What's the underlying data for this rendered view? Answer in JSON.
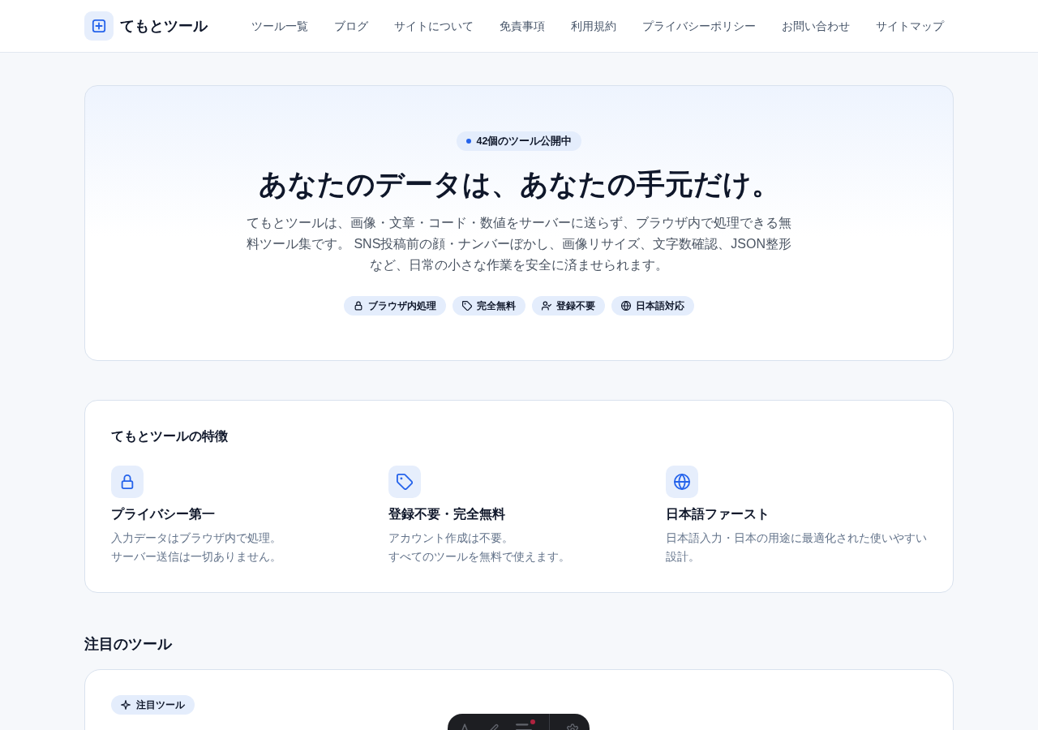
{
  "header": {
    "logo_text": "てもとツール",
    "nav": [
      "ツール一覧",
      "ブログ",
      "サイトについて",
      "免責事項",
      "利用規約",
      "プライバシーポリシー",
      "お問い合わせ",
      "サイトマップ"
    ]
  },
  "hero": {
    "badge": "42個のツール公開中",
    "title": "あなたのデータは、あなたの手元だけ。",
    "description": "てもとツールは、画像・文章・コード・数値をサーバーに送らず、ブラウザ内で処理できる無料ツール集です。 SNS投稿前の顔・ナンバーぼかし、画像リサイズ、文字数確認、JSON整形など、日常の小さな作業を安全に済ませられます。",
    "tags": [
      {
        "kind": "lock",
        "label": "ブラウザ内処理"
      },
      {
        "kind": "tag",
        "label": "完全無料"
      },
      {
        "kind": "user-check",
        "label": "登録不要"
      },
      {
        "kind": "globe",
        "label": "日本語対応"
      }
    ]
  },
  "features": {
    "title": "てもとツールの特徴",
    "items": [
      {
        "kind": "lock",
        "title": "プライバシー第一",
        "lines": [
          "入力データはブラウザ内で処理。",
          "サーバー送信は一切ありません。"
        ]
      },
      {
        "kind": "tag",
        "title": "登録不要・完全無料",
        "lines": [
          "アカウント作成は不要。",
          "すべてのツールを無料で使えます。"
        ]
      },
      {
        "kind": "globe",
        "title": "日本語ファースト",
        "lines": [
          "日本語入力・日本の用途に最適化された使いやすい設計。"
        ]
      }
    ]
  },
  "featured": {
    "heading": "注目のツール",
    "badge": "注目ツール"
  }
}
